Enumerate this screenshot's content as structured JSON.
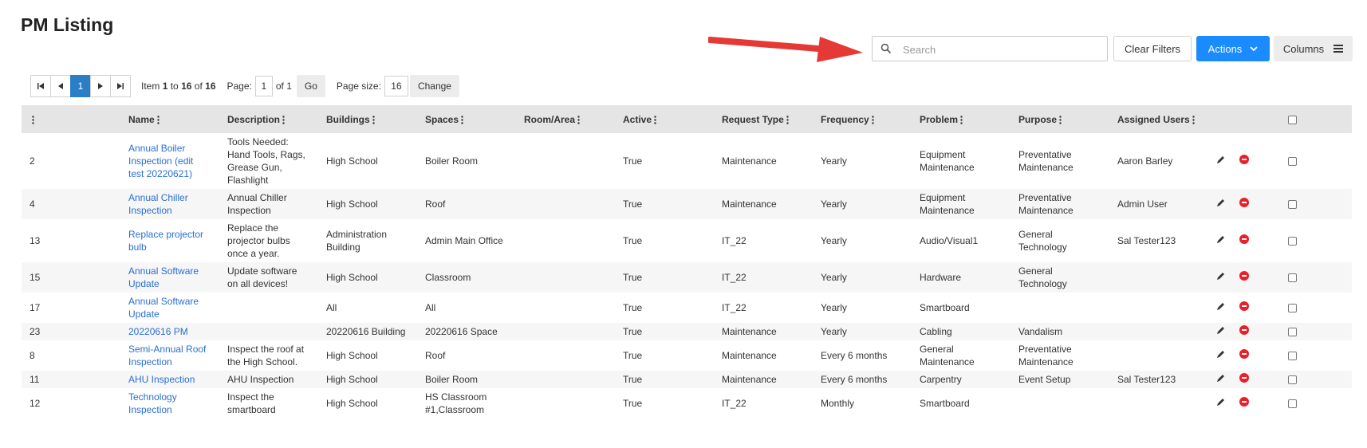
{
  "page": {
    "title": "PM Listing"
  },
  "toolbar": {
    "search_placeholder": "Search",
    "search_value": "",
    "clear_filters": "Clear Filters",
    "actions": "Actions",
    "columns": "Columns",
    "accent_color": "#1a8cff"
  },
  "pager": {
    "current_page_button": "1",
    "item_prefix": "Item",
    "item_from": "1",
    "item_to_word": "to",
    "item_to": "16",
    "item_of_word": "of",
    "item_total": "16",
    "page_label": "Page:",
    "page_value": "1",
    "page_of": "of 1",
    "go": "Go",
    "page_size_label": "Page size:",
    "page_size_value": "16",
    "change": "Change"
  },
  "table": {
    "columns": [
      "",
      "Name",
      "Description",
      "Buildings",
      "Spaces",
      "Room/Area",
      "Active",
      "Request Type",
      "Frequency",
      "Problem",
      "Purpose",
      "Assigned Users"
    ],
    "rows": [
      {
        "id": "2",
        "name": "Annual Boiler Inspection (edit test 20220621)",
        "description": "Tools Needed: Hand Tools, Rags, Grease Gun, Flashlight",
        "buildings": "High School",
        "spaces": "Boiler Room",
        "room": "",
        "active": "True",
        "request_type": "Maintenance",
        "frequency": "Yearly",
        "problem": "Equipment Maintenance",
        "purpose": "Preventative Maintenance",
        "assigned": "Aaron Barley"
      },
      {
        "id": "4",
        "name": "Annual Chiller Inspection",
        "description": "Annual Chiller Inspection",
        "buildings": "High School",
        "spaces": "Roof",
        "room": "",
        "active": "True",
        "request_type": "Maintenance",
        "frequency": "Yearly",
        "problem": "Equipment Maintenance",
        "purpose": "Preventative Maintenance",
        "assigned": "Admin User"
      },
      {
        "id": "13",
        "name": "Replace projector bulb",
        "description": "Replace the projector bulbs once a year.",
        "buildings": "Administration Building",
        "spaces": "Admin Main Office",
        "room": "",
        "active": "True",
        "request_type": "IT_22",
        "frequency": "Yearly",
        "problem": "Audio/Visual1",
        "purpose": "General Technology",
        "assigned": "Sal Tester123"
      },
      {
        "id": "15",
        "name": "Annual Software Update",
        "description": "Update software on all devices!",
        "buildings": "High School",
        "spaces": "Classroom",
        "room": "",
        "active": "True",
        "request_type": "IT_22",
        "frequency": "Yearly",
        "problem": "Hardware",
        "purpose": "General Technology",
        "assigned": ""
      },
      {
        "id": "17",
        "name": "Annual Software Update",
        "description": "",
        "buildings": "All",
        "spaces": "All",
        "room": "",
        "active": "True",
        "request_type": "IT_22",
        "frequency": "Yearly",
        "problem": "Smartboard",
        "purpose": "",
        "assigned": ""
      },
      {
        "id": "23",
        "name": "20220616 PM",
        "description": "",
        "buildings": "20220616 Building",
        "spaces": "20220616 Space",
        "room": "",
        "active": "True",
        "request_type": "Maintenance",
        "frequency": "Yearly",
        "problem": "Cabling",
        "purpose": "Vandalism",
        "assigned": ""
      },
      {
        "id": "8",
        "name": "Semi-Annual Roof Inspection",
        "description": "Inspect the roof at the High School.",
        "buildings": "High School",
        "spaces": "Roof",
        "room": "",
        "active": "True",
        "request_type": "Maintenance",
        "frequency": "Every 6 months",
        "problem": "General Maintenance",
        "purpose": "Preventative Maintenance",
        "assigned": ""
      },
      {
        "id": "11",
        "name": "AHU Inspection",
        "description": "AHU Inspection",
        "buildings": "High School",
        "spaces": "Boiler Room",
        "room": "",
        "active": "True",
        "request_type": "Maintenance",
        "frequency": "Every 6 months",
        "problem": "Carpentry",
        "purpose": "Event Setup",
        "assigned": "Sal Tester123"
      },
      {
        "id": "12",
        "name": "Technology Inspection",
        "description": "Inspect the smartboard",
        "buildings": "High School",
        "spaces": "HS Classroom #1,Classroom",
        "room": "",
        "active": "True",
        "request_type": "IT_22",
        "frequency": "Monthly",
        "problem": "Smartboard",
        "purpose": "",
        "assigned": ""
      }
    ]
  }
}
